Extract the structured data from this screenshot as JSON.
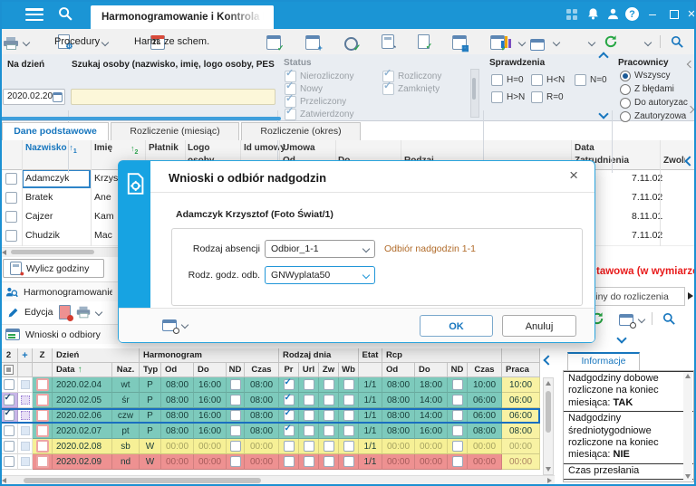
{
  "window": {
    "title_tab": "Harmonogramowanie i Kontrola RCP",
    "minimize": "–",
    "close": "×"
  },
  "toolbar": {
    "procedury": "Procedury",
    "harm_ze_schem": "Harm. ze schem."
  },
  "filters": {
    "na_dzien_label": "Na dzień",
    "na_dzien_value": "2020.02.20",
    "szukaj_label": "Szukaj osoby (nazwisko, imię, logo osoby, PESEL)",
    "szukaj_value": "",
    "status_label": "Status",
    "status_options": [
      {
        "label": "Nierozliczony",
        "checked": true
      },
      {
        "label": "Nowy",
        "checked": true
      },
      {
        "label": "Przeliczony",
        "checked": true
      },
      {
        "label": "Zatwierdzony",
        "checked": true
      },
      {
        "label": "Rozliczony",
        "checked": true
      },
      {
        "label": "Zamknięty",
        "checked": true
      }
    ],
    "sprawdzenia_label": "Sprawdzenia",
    "sprawdzenia_options": [
      {
        "label": "H=0",
        "checked": false
      },
      {
        "label": "H<N",
        "checked": false
      },
      {
        "label": "N=0",
        "checked": false
      },
      {
        "label": "H>N",
        "checked": false
      },
      {
        "label": "R=0",
        "checked": false
      }
    ],
    "pracownicy_label": "Pracownicy",
    "pracownicy_options": [
      {
        "label": "Wszyscy",
        "selected": true
      },
      {
        "label": "Z błędami",
        "selected": false
      },
      {
        "label": "Do autoryzac",
        "selected": false
      },
      {
        "label": "Zautoryzowa",
        "selected": false
      }
    ]
  },
  "tabs": [
    {
      "label": "Dane podstawowe",
      "active": true
    },
    {
      "label": "Rozliczenie (miesiąc)",
      "active": false
    },
    {
      "label": "Rozliczenie (okres)",
      "active": false
    }
  ],
  "employee_table": {
    "headers": {
      "nazwisko": "Nazwisko",
      "imie": "Imię",
      "platnik": "Płatnik",
      "logo_line1": "Logo",
      "logo_line2": "osoby",
      "id_umowy": "Id umowy",
      "umowa": "Umowa",
      "od": "Od",
      "do": "Do",
      "rodzaj": "Rodzaj",
      "data": "Data",
      "zatrudnienia": "Zatrudnienia",
      "zwolnienia": "Zwolnieni"
    },
    "rows": [
      {
        "nazwisko": "Adamczyk",
        "imie": "Krzysztof",
        "zatrudnienia": "7.11.02",
        "selected": true
      },
      {
        "nazwisko": "Bratek",
        "imie": "Ane",
        "zatrudnienia": "7.11.02",
        "selected": false
      },
      {
        "nazwisko": "Cajzer",
        "imie": "Kam",
        "zatrudnienia": "8.11.01",
        "selected": false
      },
      {
        "nazwisko": "Chudzik",
        "imie": "Mac",
        "zatrudnienia": "7.11.02",
        "selected": false
      }
    ]
  },
  "actions": {
    "wylicz": "Wylicz godziny",
    "harmonogramowanie": "Harmonogramowanie",
    "edycja": "Edycja",
    "wnioski": "Wnioski o odbiory"
  },
  "side": {
    "red_notice": "tawowa (w wymiarze",
    "rozliczenia_box": "ziny do rozliczenia"
  },
  "dialog": {
    "title": "Wnioski o odbiór nadgodzin",
    "person": "Adamczyk Krzysztof (Foto Świat/1)",
    "field1_label": "Rodzaj absencji",
    "field1_value": "Odbior_1-1",
    "field1_note": "Odbiór nadgodzin 1-1",
    "field2_label": "Rodz. godz. odb.",
    "field2_value": "GNWyplata50",
    "ok": "OK",
    "cancel": "Anuluj"
  },
  "schedule_table": {
    "group_headers": {
      "count": "2",
      "z": "Z",
      "dzien": "Dzień",
      "harmonogram": "Harmonogram",
      "rodzaj_dnia": "Rodzaj dnia",
      "etat": "Etat",
      "rcp": "Rcp"
    },
    "sub_headers": {
      "data": "Data",
      "naz": "Naz.",
      "typ": "Typ",
      "od": "Od",
      "do": "Do",
      "nd": "ND",
      "czas": "Czas",
      "pr": "Pr",
      "url": "Url",
      "zw": "Zw",
      "wb": "Wb",
      "praca": "Praca"
    },
    "rows": [
      {
        "date": "2020.02.04",
        "day": "wt",
        "typ": "P",
        "od": "08:00",
        "do": "16:00",
        "czas": "08:00",
        "pr": true,
        "url": false,
        "zw": false,
        "wb": false,
        "etat": "1/1",
        "rcp_od": "08:00",
        "rcp_do": "18:00",
        "rcp_czas": "10:00",
        "praca": "10:00",
        "color": "teal",
        "checked": false,
        "selected": false
      },
      {
        "date": "2020.02.05",
        "day": "śr",
        "typ": "P",
        "od": "08:00",
        "do": "16:00",
        "czas": "08:00",
        "pr": true,
        "url": false,
        "zw": false,
        "wb": false,
        "etat": "1/1",
        "rcp_od": "08:00",
        "rcp_do": "14:00",
        "rcp_czas": "06:00",
        "praca": "06:00",
        "color": "teal",
        "checked": true,
        "selected": false
      },
      {
        "date": "2020.02.06",
        "day": "czw",
        "typ": "P",
        "od": "08:00",
        "do": "16:00",
        "czas": "08:00",
        "pr": true,
        "url": false,
        "zw": false,
        "wb": false,
        "etat": "1/1",
        "rcp_od": "08:00",
        "rcp_do": "14:00",
        "rcp_czas": "06:00",
        "praca": "06:00",
        "color": "teal",
        "checked": true,
        "selected": true
      },
      {
        "date": "2020.02.07",
        "day": "pt",
        "typ": "P",
        "od": "08:00",
        "do": "16:00",
        "czas": "08:00",
        "pr": true,
        "url": false,
        "zw": false,
        "wb": false,
        "etat": "1/1",
        "rcp_od": "08:00",
        "rcp_do": "16:00",
        "rcp_czas": "08:00",
        "praca": "08:00",
        "color": "teal",
        "checked": false,
        "selected": false
      },
      {
        "date": "2020.02.08",
        "day": "sb",
        "typ": "W",
        "od": "00:00",
        "do": "00:00",
        "czas": "00:00",
        "pr": false,
        "url": false,
        "zw": false,
        "wb": false,
        "etat": "1/1",
        "rcp_od": "00:00",
        "rcp_do": "00:00",
        "rcp_czas": "00:00",
        "praca": "00:00",
        "color": "yellow",
        "checked": false,
        "selected": false
      },
      {
        "date": "2020.02.09",
        "day": "nd",
        "typ": "W",
        "od": "00:00",
        "do": "00:00",
        "czas": "00:00",
        "pr": false,
        "url": false,
        "zw": false,
        "wb": false,
        "etat": "1/1",
        "rcp_od": "00:00",
        "rcp_do": "00:00",
        "rcp_czas": "00:00",
        "praca": "00:00",
        "color": "red",
        "checked": false,
        "selected": false
      }
    ]
  },
  "info_panel": {
    "tab": "Informacje",
    "items": [
      {
        "text": "Nadgodziny dobowe rozliczone na koniec miesiąca:",
        "value": "TAK"
      },
      {
        "text": "Nadgodziny średniotygodniowe rozliczone na koniec miesiąca:",
        "value": "NIE"
      },
      {
        "text": "Czas przesłania",
        "value": ""
      }
    ]
  },
  "colors": {
    "titlebar": "#1b95d5",
    "accent": "#1776be",
    "modal_strip": "#17a3e2",
    "teal_row": "#7dcabc",
    "yellow_row": "#f6f096",
    "red_row": "#ee9191",
    "praca_col": "#f8f2a3",
    "checked_cell": "#c9b6e9",
    "alert_red": "#e81b1b",
    "note_orange": "#b06a28",
    "search_bg": "#fcf7d9"
  },
  "icons": {
    "hamburger-menu-icon": "css-bars",
    "search-icon": "svg-magnifier",
    "apps-grid-icon": "css-dot-grid",
    "bell-icon": "svg-bell",
    "user-icon": "svg-user",
    "help-icon": "? circle",
    "minimize-icon": "–",
    "maximize-icon": "css-box",
    "close-icon": "×",
    "printer-icon": "css-printer",
    "procedures-icon": "doc+gear",
    "calendar-23-icon": "css-calendar-23",
    "stopwatch-icon": "circle+check",
    "calculator-icon": "css-calc",
    "document-check-icon": "doc+check",
    "chart-icon": "svg-bars",
    "windows-icon": "overlapping-squares",
    "warning-settings-icon": "window+!",
    "refresh-icon": "svg-green-arrows",
    "window-settings-icon": "window+gear",
    "magnifier-icon": "svg-magnifier",
    "pencil-icon": "svg-pencil",
    "person-search-icon": "svg-person+magnifier",
    "plus-icon": "+",
    "sort-asc-icon": "↑",
    "triangle-right-icon": "▶",
    "chevron-icon": "css-chevron"
  }
}
